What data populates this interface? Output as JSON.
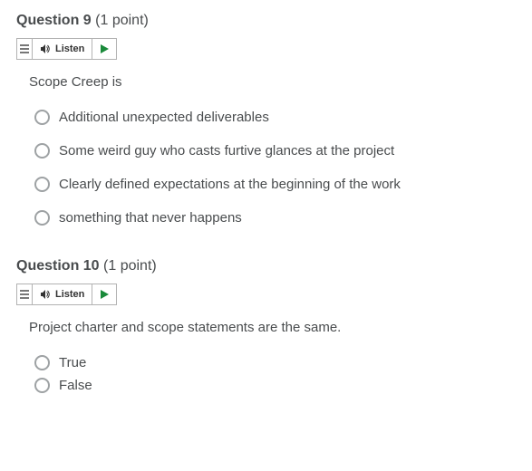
{
  "questions": [
    {
      "number": "Question 9",
      "points": "(1 point)",
      "listen_label": "Listen",
      "prompt": "Scope Creep is",
      "options": [
        "Additional unexpected deliverables",
        "Some weird guy who casts furtive glances at the project",
        "Clearly defined expectations at the beginning of the work",
        "something that never happens"
      ]
    },
    {
      "number": "Question 10",
      "points": "(1 point)",
      "listen_label": "Listen",
      "prompt": "Project charter and scope statements are the same.",
      "options": [
        "True",
        "False"
      ]
    }
  ]
}
